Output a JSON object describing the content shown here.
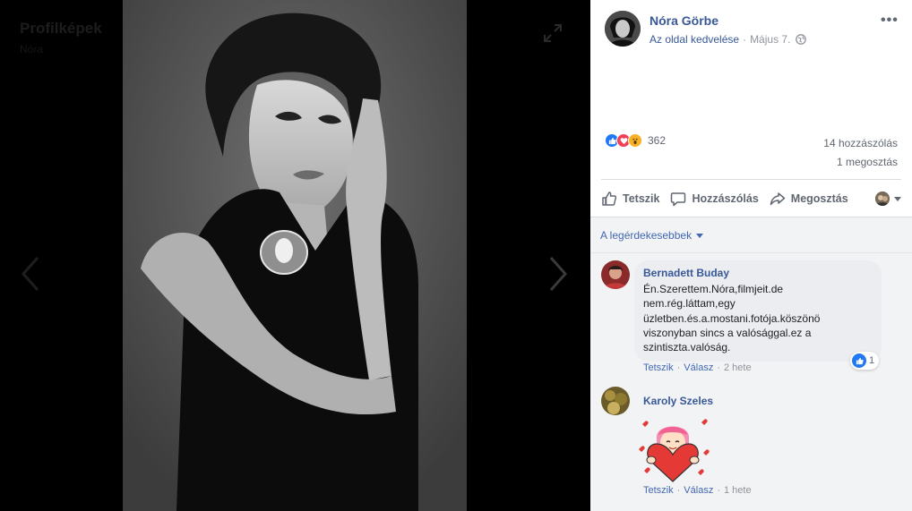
{
  "viewer": {
    "album_title": "Profilképek",
    "album_sub": "Nóra",
    "expand_icon": "expand-icon",
    "prev_icon": "chevron-left-icon",
    "next_icon": "chevron-right-icon"
  },
  "post": {
    "author": "Nóra Görbe",
    "like_page": "Az oldal kedvelése",
    "date": "Május 7.",
    "privacy_icon": "globe-icon",
    "more_icon": "more-options-icon",
    "more_label": "•••",
    "reaction_count": "362",
    "reactions": [
      "like",
      "love",
      "wow"
    ],
    "comments_count": "14 hozzászólás",
    "shares_count": "1 megosztás"
  },
  "actions": {
    "like": "Tetszik",
    "comment": "Hozzászólás",
    "share": "Megosztás"
  },
  "comments_sort": "A legérdekesebbek",
  "comments": [
    {
      "name": "Bernadett Buday",
      "text": "Én.Szerettem.Nóra,filmjeit.de nem.rég.láttam,egy üzletben.és.a.mostani.fotója.köszönö viszonyban sincs a valósággal.ez a szintiszta.valóság.",
      "like_count": "1",
      "like": "Tetszik",
      "reply": "Válasz",
      "time": "2 hete"
    },
    {
      "name": "Karoly Szeles",
      "sticker": "heart-sticker",
      "like": "Tetszik",
      "reply": "Válasz",
      "time": "1 hete"
    }
  ],
  "colors": {
    "link": "#385898",
    "muted": "#90949c",
    "like_blue": "#2078f4",
    "love_red": "#f33e58",
    "wow_yellow": "#f7b125"
  }
}
